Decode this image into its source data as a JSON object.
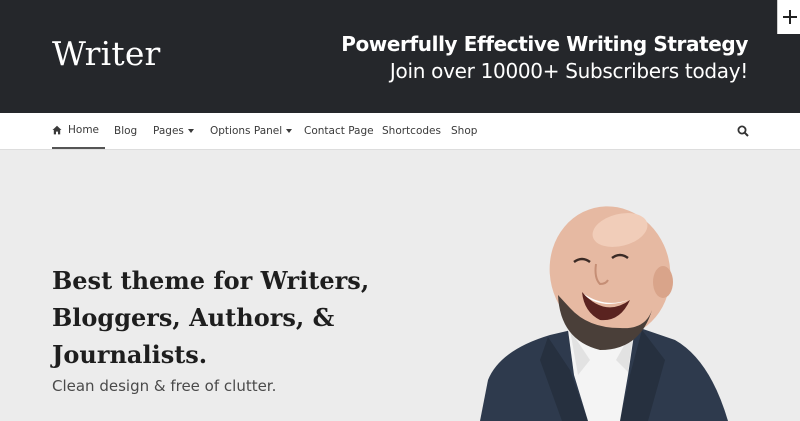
{
  "header": {
    "logo": "Writer",
    "tagline_line1": "Powerfully Effective Writing Strategy",
    "tagline_line2": "Join over 10000+ Subscribers today!"
  },
  "corner_button": {
    "icon": "plus-icon"
  },
  "nav": {
    "items": [
      {
        "label": "Home",
        "icon": "home-icon",
        "active": true
      },
      {
        "label": "Blog"
      },
      {
        "label": "Pages",
        "dropdown": true
      },
      {
        "label": "Options Panel",
        "dropdown": true
      },
      {
        "label": "Contact Page"
      },
      {
        "label": "Shortcodes"
      },
      {
        "label": "Shop"
      }
    ],
    "search_icon": "search-icon"
  },
  "hero": {
    "title": "Best theme for Writers, Bloggers, Authors, & Journalists.",
    "subtitle": "Clean design & free of clutter.",
    "image": "laughing-bald-bearded-man-photo"
  },
  "colors": {
    "header_bg": "#25272b",
    "nav_bg": "#ffffff",
    "hero_bg": "#ececec",
    "text_dark": "#1e1e1e"
  }
}
